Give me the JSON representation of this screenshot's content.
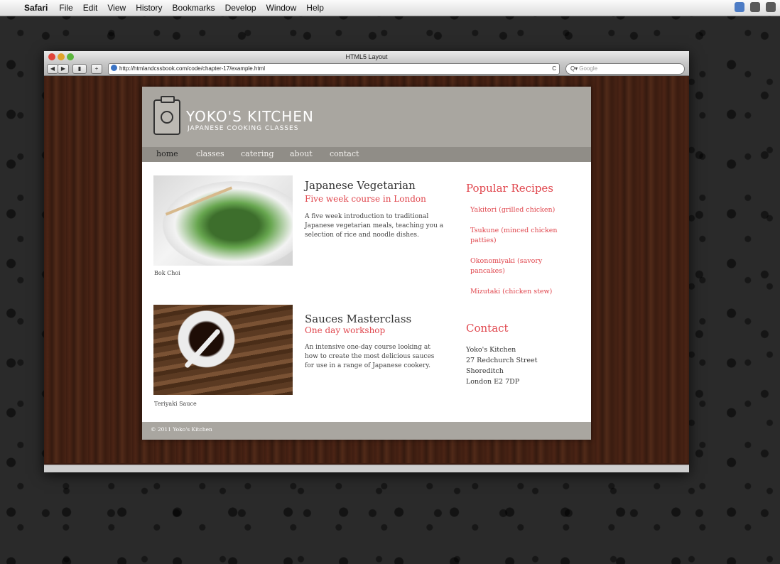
{
  "menubar": {
    "app_name": "Safari",
    "items": [
      "File",
      "Edit",
      "View",
      "History",
      "Bookmarks",
      "Develop",
      "Window",
      "Help"
    ]
  },
  "window": {
    "title": "HTML5 Layout",
    "url": "http://htmlandcssbook.com/code/chapter-17/example.html",
    "search_placeholder": "Google",
    "back_icon": "back-arrow-icon",
    "forward_icon": "forward-arrow-icon"
  },
  "site": {
    "title": "YOKO'S KITCHEN",
    "subtitle": "JAPANESE COOKING CLASSES",
    "nav": [
      "home",
      "classes",
      "catering",
      "about",
      "contact"
    ],
    "articles": [
      {
        "caption": "Bok Choi",
        "title": "Japanese Vegetarian",
        "subtitle": "Five week course in London",
        "body": "A five week introduction to traditional Japanese vegetarian meals, teaching you a selection of rice and noodle dishes."
      },
      {
        "caption": "Teriyaki Sauce",
        "title": "Sauces Masterclass",
        "subtitle": "One day workshop",
        "body": "An intensive one-day course looking at how to create the most delicious sauces for use in a range of Japanese cookery."
      }
    ],
    "sidebar": {
      "recipes_heading": "Popular Recipes",
      "recipes": [
        "Yakitori (grilled chicken)",
        "Tsukune (minced chicken patties)",
        "Okonomiyaki (savory pancakes)",
        "Mizutaki (chicken stew)"
      ],
      "contact_heading": "Contact",
      "contact": [
        "Yoko's Kitchen",
        "27 Redchurch Street",
        "Shoreditch",
        "London E2 7DP"
      ]
    },
    "footer": "© 2011 Yoko's Kitchen"
  }
}
